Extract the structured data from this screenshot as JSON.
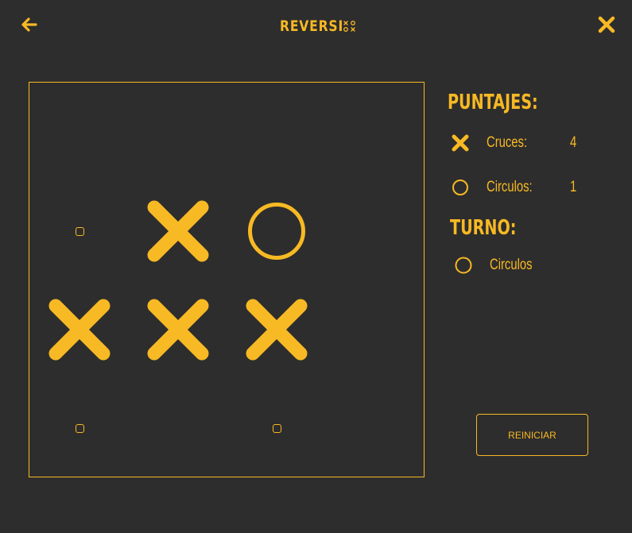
{
  "header": {
    "logo_text": "REVERSI",
    "logo_glyphs": "×○○×",
    "back_icon": "arrow-left-icon",
    "close_icon": "close-x-icon"
  },
  "colors": {
    "background": "#2e2d2d",
    "accent": "#f7b924"
  },
  "board": {
    "size": 4,
    "cells": [
      [
        "",
        "",
        "",
        ""
      ],
      [
        "hint",
        "X",
        "O",
        ""
      ],
      [
        "X",
        "X",
        "X",
        ""
      ],
      [
        "hint",
        "",
        "hint",
        ""
      ]
    ]
  },
  "scores": {
    "title": "PUNTAJES:",
    "crosses_label": "Cruces:",
    "crosses_value": "4",
    "circles_label": "Circulos:",
    "circles_value": "1"
  },
  "turn": {
    "title": "TURNO:",
    "current_player": "Circulos"
  },
  "reset_label": "REINICIAR"
}
